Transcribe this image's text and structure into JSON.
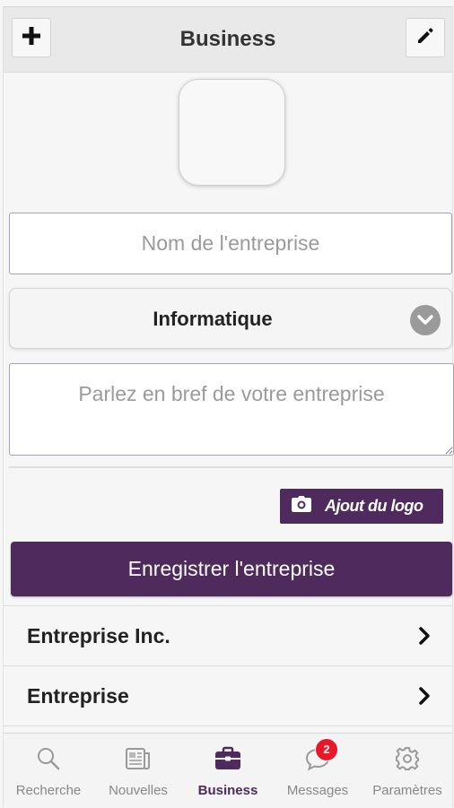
{
  "header": {
    "title": "Business",
    "add_icon": "plus-icon",
    "edit_icon": "pencil-icon"
  },
  "form": {
    "name_placeholder": "Nom de l'entreprise",
    "category_selected": "Informatique",
    "description_placeholder": "Parlez en bref de votre entreprise",
    "logo_button_label": "Ajout du logo",
    "save_button_label": "Enregistrer l'entreprise"
  },
  "businesses": [
    {
      "name": "Entreprise Inc."
    },
    {
      "name": "Entreprise"
    }
  ],
  "tabbar": {
    "tabs": [
      {
        "label": "Recherche",
        "icon": "search-icon"
      },
      {
        "label": "Nouvelles",
        "icon": "newspaper-icon"
      },
      {
        "label": "Business",
        "icon": "briefcase-icon",
        "active": true
      },
      {
        "label": "Messages",
        "icon": "chat-bubble-icon",
        "badge": "2"
      },
      {
        "label": "Paramètres",
        "icon": "gear-icon"
      }
    ]
  },
  "colors": {
    "accent": "#4f2a5d",
    "badge": "#e8182a",
    "background": "#f6f6f6"
  }
}
